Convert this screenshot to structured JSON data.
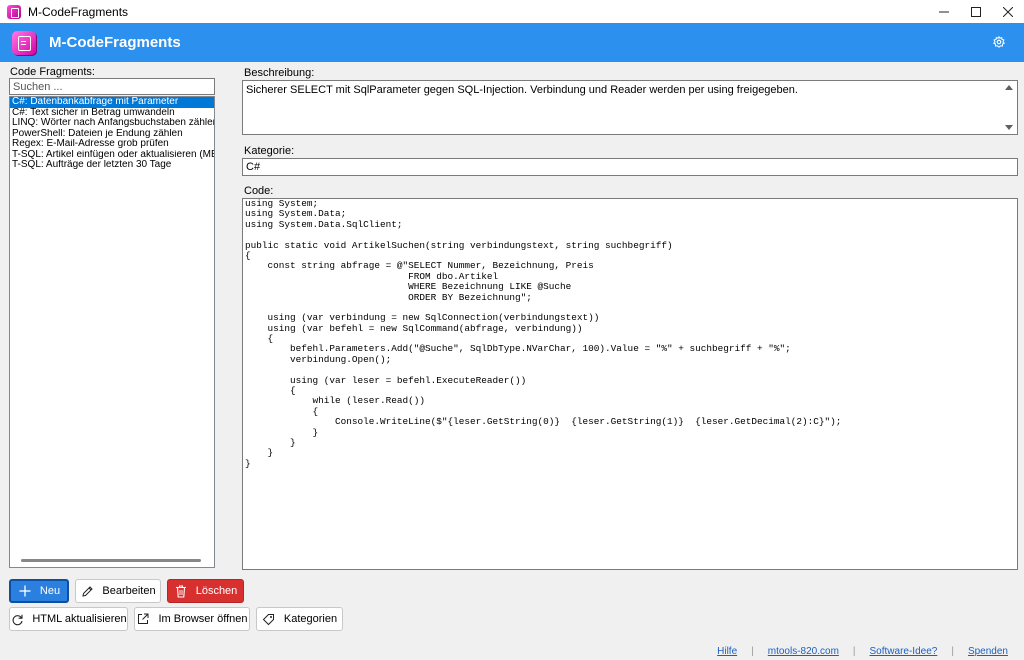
{
  "window": {
    "title": "M-CodeFragments",
    "controls": [
      "minimize",
      "maximize",
      "close"
    ]
  },
  "header": {
    "app_name": "M-CodeFragments",
    "settings_icon": "gear-icon",
    "accent_color": "#2b90ee"
  },
  "left": {
    "label": "Code Fragments:",
    "search_placeholder": "Suchen ...",
    "items": [
      {
        "label": "C#: Datenbankabfrage mit Parameter",
        "selected": true
      },
      {
        "label": "C#: Text sicher in Betrag umwandeln",
        "selected": false
      },
      {
        "label": "LINQ: Wörter nach Anfangsbuchstaben zählen",
        "selected": false
      },
      {
        "label": "PowerShell: Dateien je Endung zählen",
        "selected": false
      },
      {
        "label": "Regex: E-Mail-Adresse grob prüfen",
        "selected": false
      },
      {
        "label": "T-SQL: Artikel einfügen oder aktualisieren (MERGE)",
        "selected": false
      },
      {
        "label": "T-SQL: Aufträge der letzten 30 Tage",
        "selected": false
      }
    ]
  },
  "right": {
    "description_label": "Beschreibung:",
    "description": "Sicherer SELECT mit SqlParameter gegen SQL-Injection. Verbindung und Reader werden per using freigegeben.",
    "category_label": "Kategorie:",
    "category": "C#",
    "code_label": "Code:",
    "code_lines": [
      "using System;",
      "using System.Data;",
      "using System.Data.SqlClient;",
      "",
      "public static void ArtikelSuchen(string verbindungstext, string suchbegriff)",
      "{",
      "    const string abfrage = @\"SELECT Nummer, Bezeichnung, Preis",
      "                             FROM dbo.Artikel",
      "                             WHERE Bezeichnung LIKE @Suche",
      "                             ORDER BY Bezeichnung\";",
      "",
      "    using (var verbindung = new SqlConnection(verbindungstext))",
      "    using (var befehl = new SqlCommand(abfrage, verbindung))",
      "    {",
      "        befehl.Parameters.Add(\"@Suche\", SqlDbType.NVarChar, 100).Value = \"%\" + suchbegriff + \"%\";",
      "        verbindung.Open();",
      "",
      "        using (var leser = befehl.ExecuteReader())",
      "        {",
      "            while (leser.Read())",
      "            {",
      "                Console.WriteLine($\"{leser.GetString(0)}  {leser.GetString(1)}  {leser.GetDecimal(2):C}\");",
      "            }",
      "        }",
      "    }",
      "}"
    ]
  },
  "buttons": {
    "new": "Neu",
    "edit": "Bearbeiten",
    "delete": "Löschen",
    "refresh_html": "HTML aktualisieren",
    "open_browser": "Im Browser öffnen",
    "categories": "Kategorien"
  },
  "footer": {
    "links": [
      "Hilfe",
      "mtools-820.com",
      "Software-Idee?",
      "Spenden"
    ]
  },
  "colors": {
    "primary_button": "#2b7fde",
    "danger_button": "#d8302f",
    "selection": "#0078d7",
    "link": "#1a5fc2"
  }
}
